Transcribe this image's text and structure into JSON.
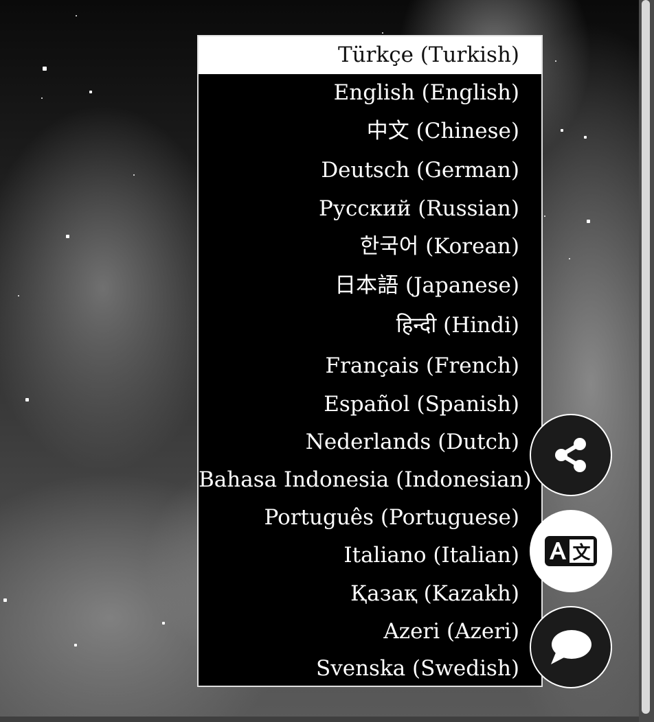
{
  "language_menu": {
    "selected_index": 0,
    "options": [
      {
        "label": "Türkçe (Turkish)"
      },
      {
        "label": "English (English)"
      },
      {
        "label": "中文 (Chinese)"
      },
      {
        "label": "Deutsch (German)"
      },
      {
        "label": "Русский (Russian)"
      },
      {
        "label": "한국어 (Korean)"
      },
      {
        "label": "日本語 (Japanese)"
      },
      {
        "label": "हिन्दी (Hindi)"
      },
      {
        "label": "Français (French)"
      },
      {
        "label": "Español (Spanish)"
      },
      {
        "label": "Nederlands (Dutch)"
      },
      {
        "label": "Bahasa Indonesia (Indonesian)"
      },
      {
        "label": "Português (Portuguese)"
      },
      {
        "label": "Italiano (Italian)"
      },
      {
        "label": "Қазақ (Kazakh)"
      },
      {
        "label": "Azeri (Azeri)"
      },
      {
        "label": "Svenska (Swedish)"
      }
    ]
  },
  "floating_buttons": {
    "share": {
      "icon": "share-icon"
    },
    "translate": {
      "icon": "translate-icon"
    },
    "chat": {
      "icon": "chat-bubble-icon"
    }
  },
  "colors": {
    "menu_background": "#000000",
    "menu_selected_background": "#ffffff",
    "menu_text": "#ffffff",
    "menu_selected_text": "#111111"
  }
}
